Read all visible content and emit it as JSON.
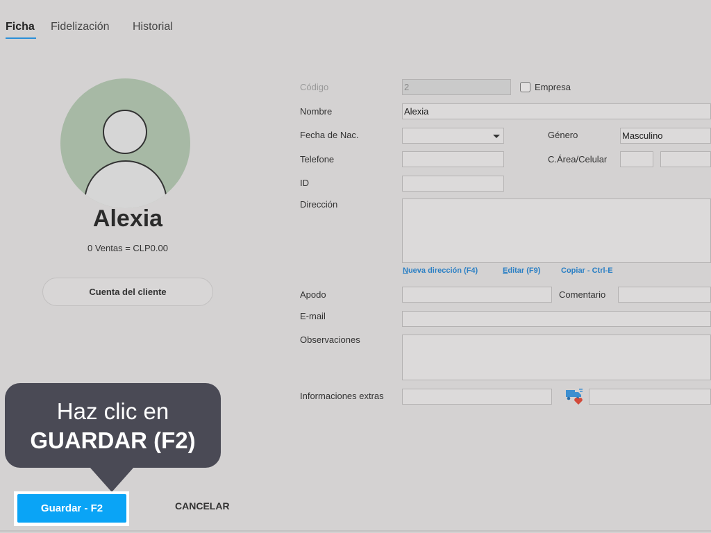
{
  "tabs": [
    {
      "label": "Ficha",
      "active": true
    },
    {
      "label": "Fidelización",
      "active": false
    },
    {
      "label": "Historial",
      "active": false
    }
  ],
  "customer": {
    "name": "Alexia",
    "sales_summary": "0 Ventas = CLP0.00",
    "account_button": "Cuenta del cliente"
  },
  "form": {
    "codigo": {
      "label": "Código",
      "value": "2"
    },
    "empresa": {
      "label": "Empresa",
      "checked": false
    },
    "nombre": {
      "label": "Nombre",
      "value": "Alexia"
    },
    "fecha_nac": {
      "label": "Fecha de Nac.",
      "value": ""
    },
    "genero": {
      "label": "Género",
      "value": "Masculino"
    },
    "telefone": {
      "label": "Telefone",
      "value": ""
    },
    "celular": {
      "label": "C.Área/Celular",
      "area": "",
      "number": ""
    },
    "id": {
      "label": "ID",
      "value": ""
    },
    "direccion": {
      "label": "Dirección",
      "value": ""
    },
    "address_links": {
      "nueva_key": "N",
      "nueva_rest": "ueva dirección (F4)",
      "editar_key": "E",
      "editar_rest": "ditar (F9)",
      "copiar": "Copiar - Ctrl-E"
    },
    "apodo": {
      "label": "Apodo",
      "value": ""
    },
    "comentario": {
      "label": "Comentario",
      "value": ""
    },
    "email": {
      "label": "E-mail",
      "value": ""
    },
    "observaciones": {
      "label": "Observaciones",
      "value": ""
    },
    "informaciones_extras": {
      "label": "Informaciones extras",
      "value": "",
      "value2": ""
    }
  },
  "callout": {
    "line1": "Haz clic en",
    "line2": "GUARDAR (F2)"
  },
  "buttons": {
    "save": "Guardar - F2",
    "cancel": "CANCELAR"
  },
  "colors": {
    "accent": "#0aa4f6",
    "link": "#2a7fc4",
    "avatar_bg": "#a7b9a5",
    "callout_bg": "#4a4a55"
  },
  "icons": {
    "avatar": "user-avatar-icon",
    "delivery": "delivery-truck-heart-icon",
    "dropdown": "dropdown-arrow-icon"
  }
}
